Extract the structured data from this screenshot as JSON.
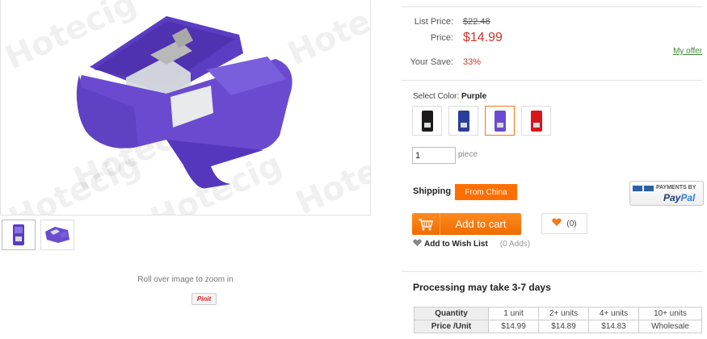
{
  "gallery": {
    "watermark": "Hotecig",
    "zoom_hint": "Roll over image to zoom in",
    "pinit_label": "Pinit"
  },
  "pricing": {
    "list_price_label": "List Price:",
    "list_price": "$22.48",
    "price_label": "Price:",
    "price": "$14.99",
    "save_label": "Your Save:",
    "save_value": "33%",
    "my_offer": "My offer"
  },
  "color": {
    "label": "Select Color:",
    "selected": "Purple",
    "options": [
      {
        "name": "Black",
        "hex": "#1a1a1a"
      },
      {
        "name": "Blue",
        "hex": "#2b3d9a"
      },
      {
        "name": "Purple",
        "hex": "#6a4bd0"
      },
      {
        "name": "Red",
        "hex": "#d8161a"
      }
    ]
  },
  "quantity": {
    "value": "1",
    "unit": "piece"
  },
  "shipping": {
    "label": "Shipping",
    "from": "From China"
  },
  "paypal": {
    "top": "PAYMENTS BY",
    "brand_a": "Pay",
    "brand_b": "Pal"
  },
  "actions": {
    "add_to_cart": "Add to cart",
    "like_count": "(0)",
    "wishlist": "Add to Wish List",
    "wishlist_count": "(0 Adds)"
  },
  "processing": "Processing may take 3-7 days",
  "tier_table": {
    "headers": [
      "Quantity",
      "1 unit",
      "2+ units",
      "4+ units",
      "10+ units"
    ],
    "row": [
      "Price /Unit",
      "$14.99",
      "$14.89",
      "$14.83",
      "Wholesale"
    ]
  },
  "colors": {
    "accent_orange": "#ff6f00",
    "price_red": "#d0342c",
    "product_purple": "#6a4bd0"
  }
}
